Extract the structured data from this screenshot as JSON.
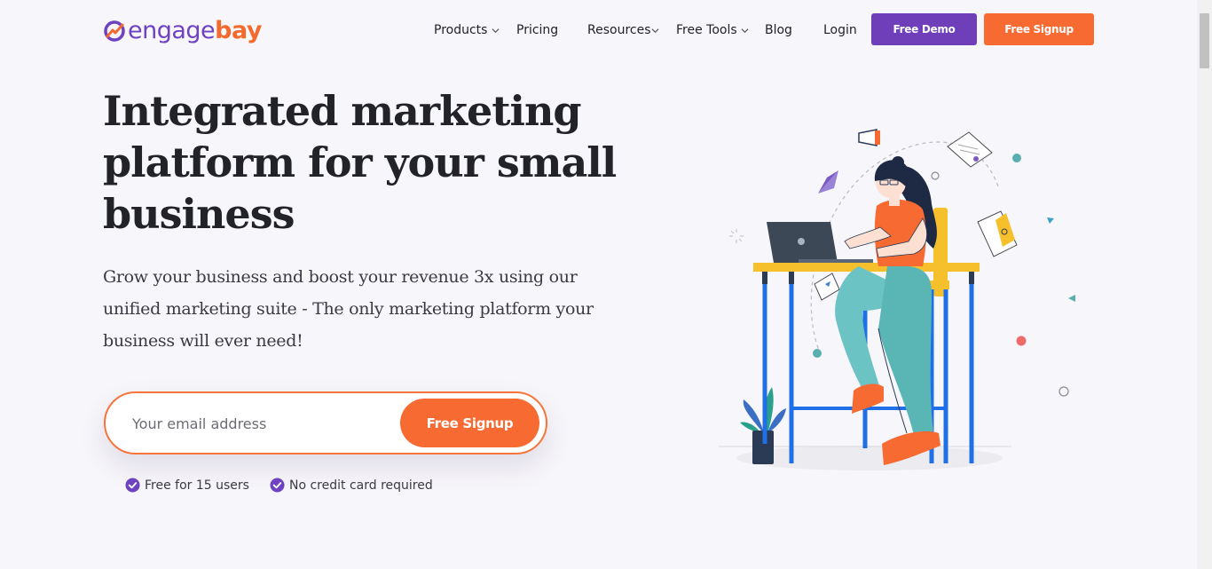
{
  "logo": {
    "prefix": "engage",
    "suffix": "bay"
  },
  "nav": {
    "items": [
      {
        "label": "Products",
        "has_dropdown": true
      },
      {
        "label": "Pricing",
        "has_dropdown": false
      },
      {
        "label": "Resources",
        "has_dropdown": true
      },
      {
        "label": "Free Tools",
        "has_dropdown": true
      },
      {
        "label": "Blog",
        "has_dropdown": false
      },
      {
        "label": "Login",
        "has_dropdown": false
      }
    ],
    "demo_label": "Free Demo",
    "signup_label": "Free Signup"
  },
  "hero": {
    "title": "Integrated marketing platform for your small business",
    "subtitle": "Grow your business and boost your revenue 3x using our unified marketing suite - The only marketing platform your business will ever need!",
    "email_placeholder": "Your email address",
    "cta_label": "Free Signup",
    "perks": [
      "Free for 15 users",
      "No credit card required"
    ]
  },
  "colors": {
    "brand_purple": "#6f42c1",
    "brand_orange": "#f76b32",
    "background": "#f7f6fa"
  }
}
